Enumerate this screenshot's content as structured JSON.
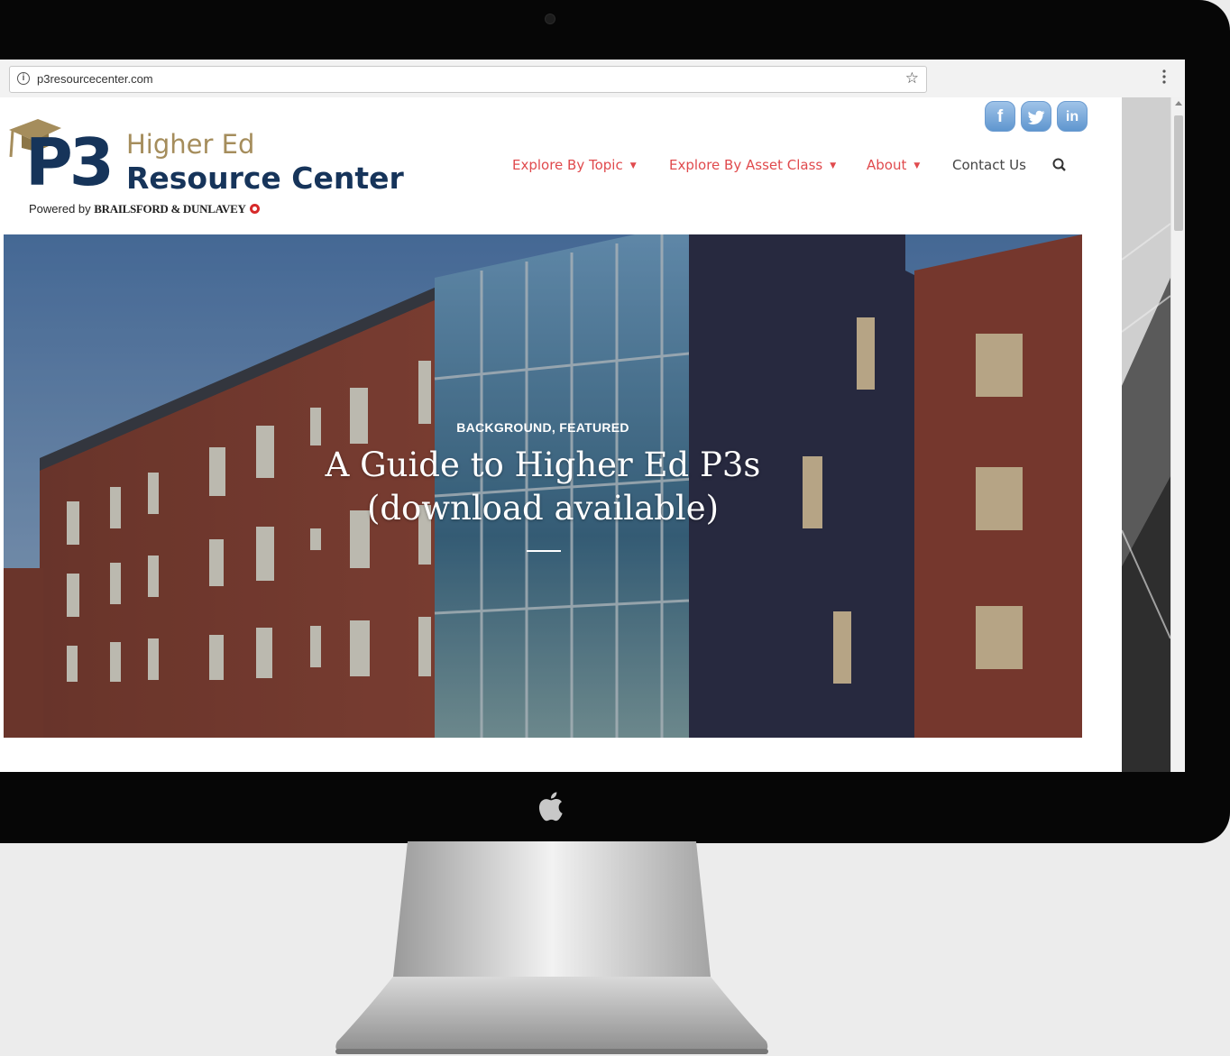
{
  "browser": {
    "url": "p3resourcecenter.com",
    "info_icon": "i",
    "star_icon": "☆",
    "menu_icon": "⋮"
  },
  "logo": {
    "mark": "P3",
    "line1": "Higher Ed",
    "line2": "Resource Center",
    "powered_prefix": "Powered by ",
    "powered_brand": "BRAILSFORD & DUNLAVEY"
  },
  "social": {
    "facebook": "f",
    "twitter": "t",
    "linkedin": "in"
  },
  "nav": {
    "topic": "Explore By Topic",
    "asset": "Explore By Asset Class",
    "about": "About",
    "contact": "Contact Us",
    "caret": "▼"
  },
  "hero": {
    "categories": "BACKGROUND, FEATURED",
    "title": "A Guide to Higher Ed P3s (download available)"
  },
  "colors": {
    "nav_accent": "#e04a4d",
    "logo_navy": "#16345a",
    "logo_gold": "#a58d5c",
    "social_blue": "#5f96cf"
  }
}
